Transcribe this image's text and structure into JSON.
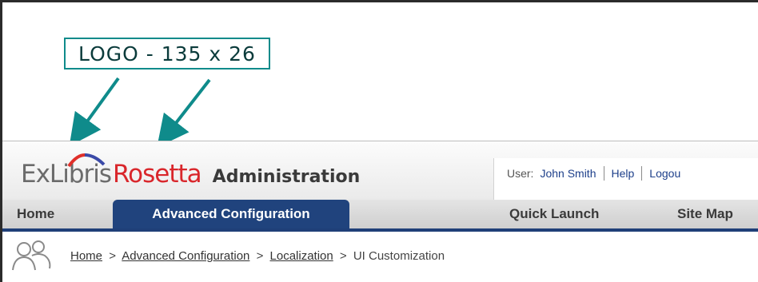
{
  "annotation": {
    "label": "LOGO - 135 x 26",
    "color": "#0f8b8b"
  },
  "logo": {
    "brand": "ExLibris",
    "product": "Rosetta",
    "section": "Administration",
    "brand_color": "#6b6b6b",
    "product_color": "#d9262b"
  },
  "user_bar": {
    "user_label": "User:",
    "user_name": "John Smith",
    "help": "Help",
    "logout": "Logou"
  },
  "nav": {
    "items": [
      {
        "label": "Home",
        "active": false
      },
      {
        "label": "Advanced Configuration",
        "active": true
      },
      {
        "label": "Quick Launch",
        "active": false
      },
      {
        "label": "Site Map",
        "active": false
      }
    ],
    "active_color": "#20437d"
  },
  "breadcrumb": {
    "icon": "users-icon",
    "items": [
      "Home",
      "Advanced Configuration",
      "Localization",
      "UI Customization"
    ],
    "separator": ">"
  }
}
